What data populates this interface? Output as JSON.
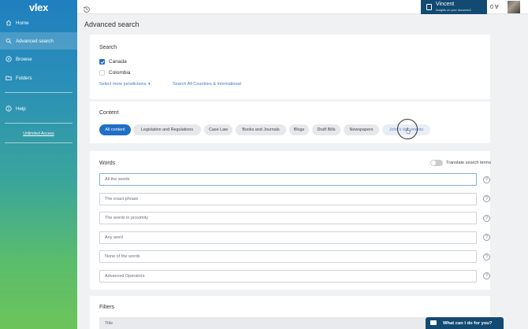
{
  "brand": {
    "logo": "vlex"
  },
  "sidebar": {
    "items": [
      {
        "label": "Home"
      },
      {
        "label": "Advanced search"
      },
      {
        "label": "Browse"
      },
      {
        "label": "Folders"
      },
      {
        "label": "Help"
      }
    ],
    "unlimited_access": "Unlimited Access"
  },
  "topbar": {
    "user_name": "Vincent",
    "user_subtitle": "Insights on your document",
    "counter": "0",
    "counter_symbol": "∀"
  },
  "page": {
    "title": "Advanced search"
  },
  "search_section": {
    "title": "Search",
    "jurisdictions": [
      {
        "label": "Canada",
        "checked": true
      },
      {
        "label": "Colombia",
        "checked": false
      }
    ],
    "select_more": "Select more jurisdictions",
    "search_all": "Search All Countries & International"
  },
  "content_section": {
    "title": "Content",
    "chips": [
      "All content",
      "Legislation and Regulations",
      "Case Law",
      "Books and Journals",
      "Blogs",
      "Draft Bills",
      "Newspapers",
      "John's documents"
    ],
    "active_chip": "All content"
  },
  "words_section": {
    "title": "Words",
    "translate_label": "Translate search terms",
    "translate_on": false,
    "fields": [
      {
        "placeholder": "All the words"
      },
      {
        "placeholder": "The exact phrase"
      },
      {
        "placeholder": "The words in proximity"
      },
      {
        "placeholder": "Any word"
      },
      {
        "placeholder": "None of the words"
      },
      {
        "placeholder": "Advanced Operators"
      }
    ],
    "help_symbol": "?"
  },
  "filters_section": {
    "title": "Filters",
    "first_filter": "Title"
  },
  "chat": {
    "label": "What can I do for you?"
  },
  "colors": {
    "accent": "#1f6fc4",
    "navy": "#124a72",
    "sidebar_top": "#1f7fbf",
    "sidebar_bottom": "#6cc45a"
  }
}
